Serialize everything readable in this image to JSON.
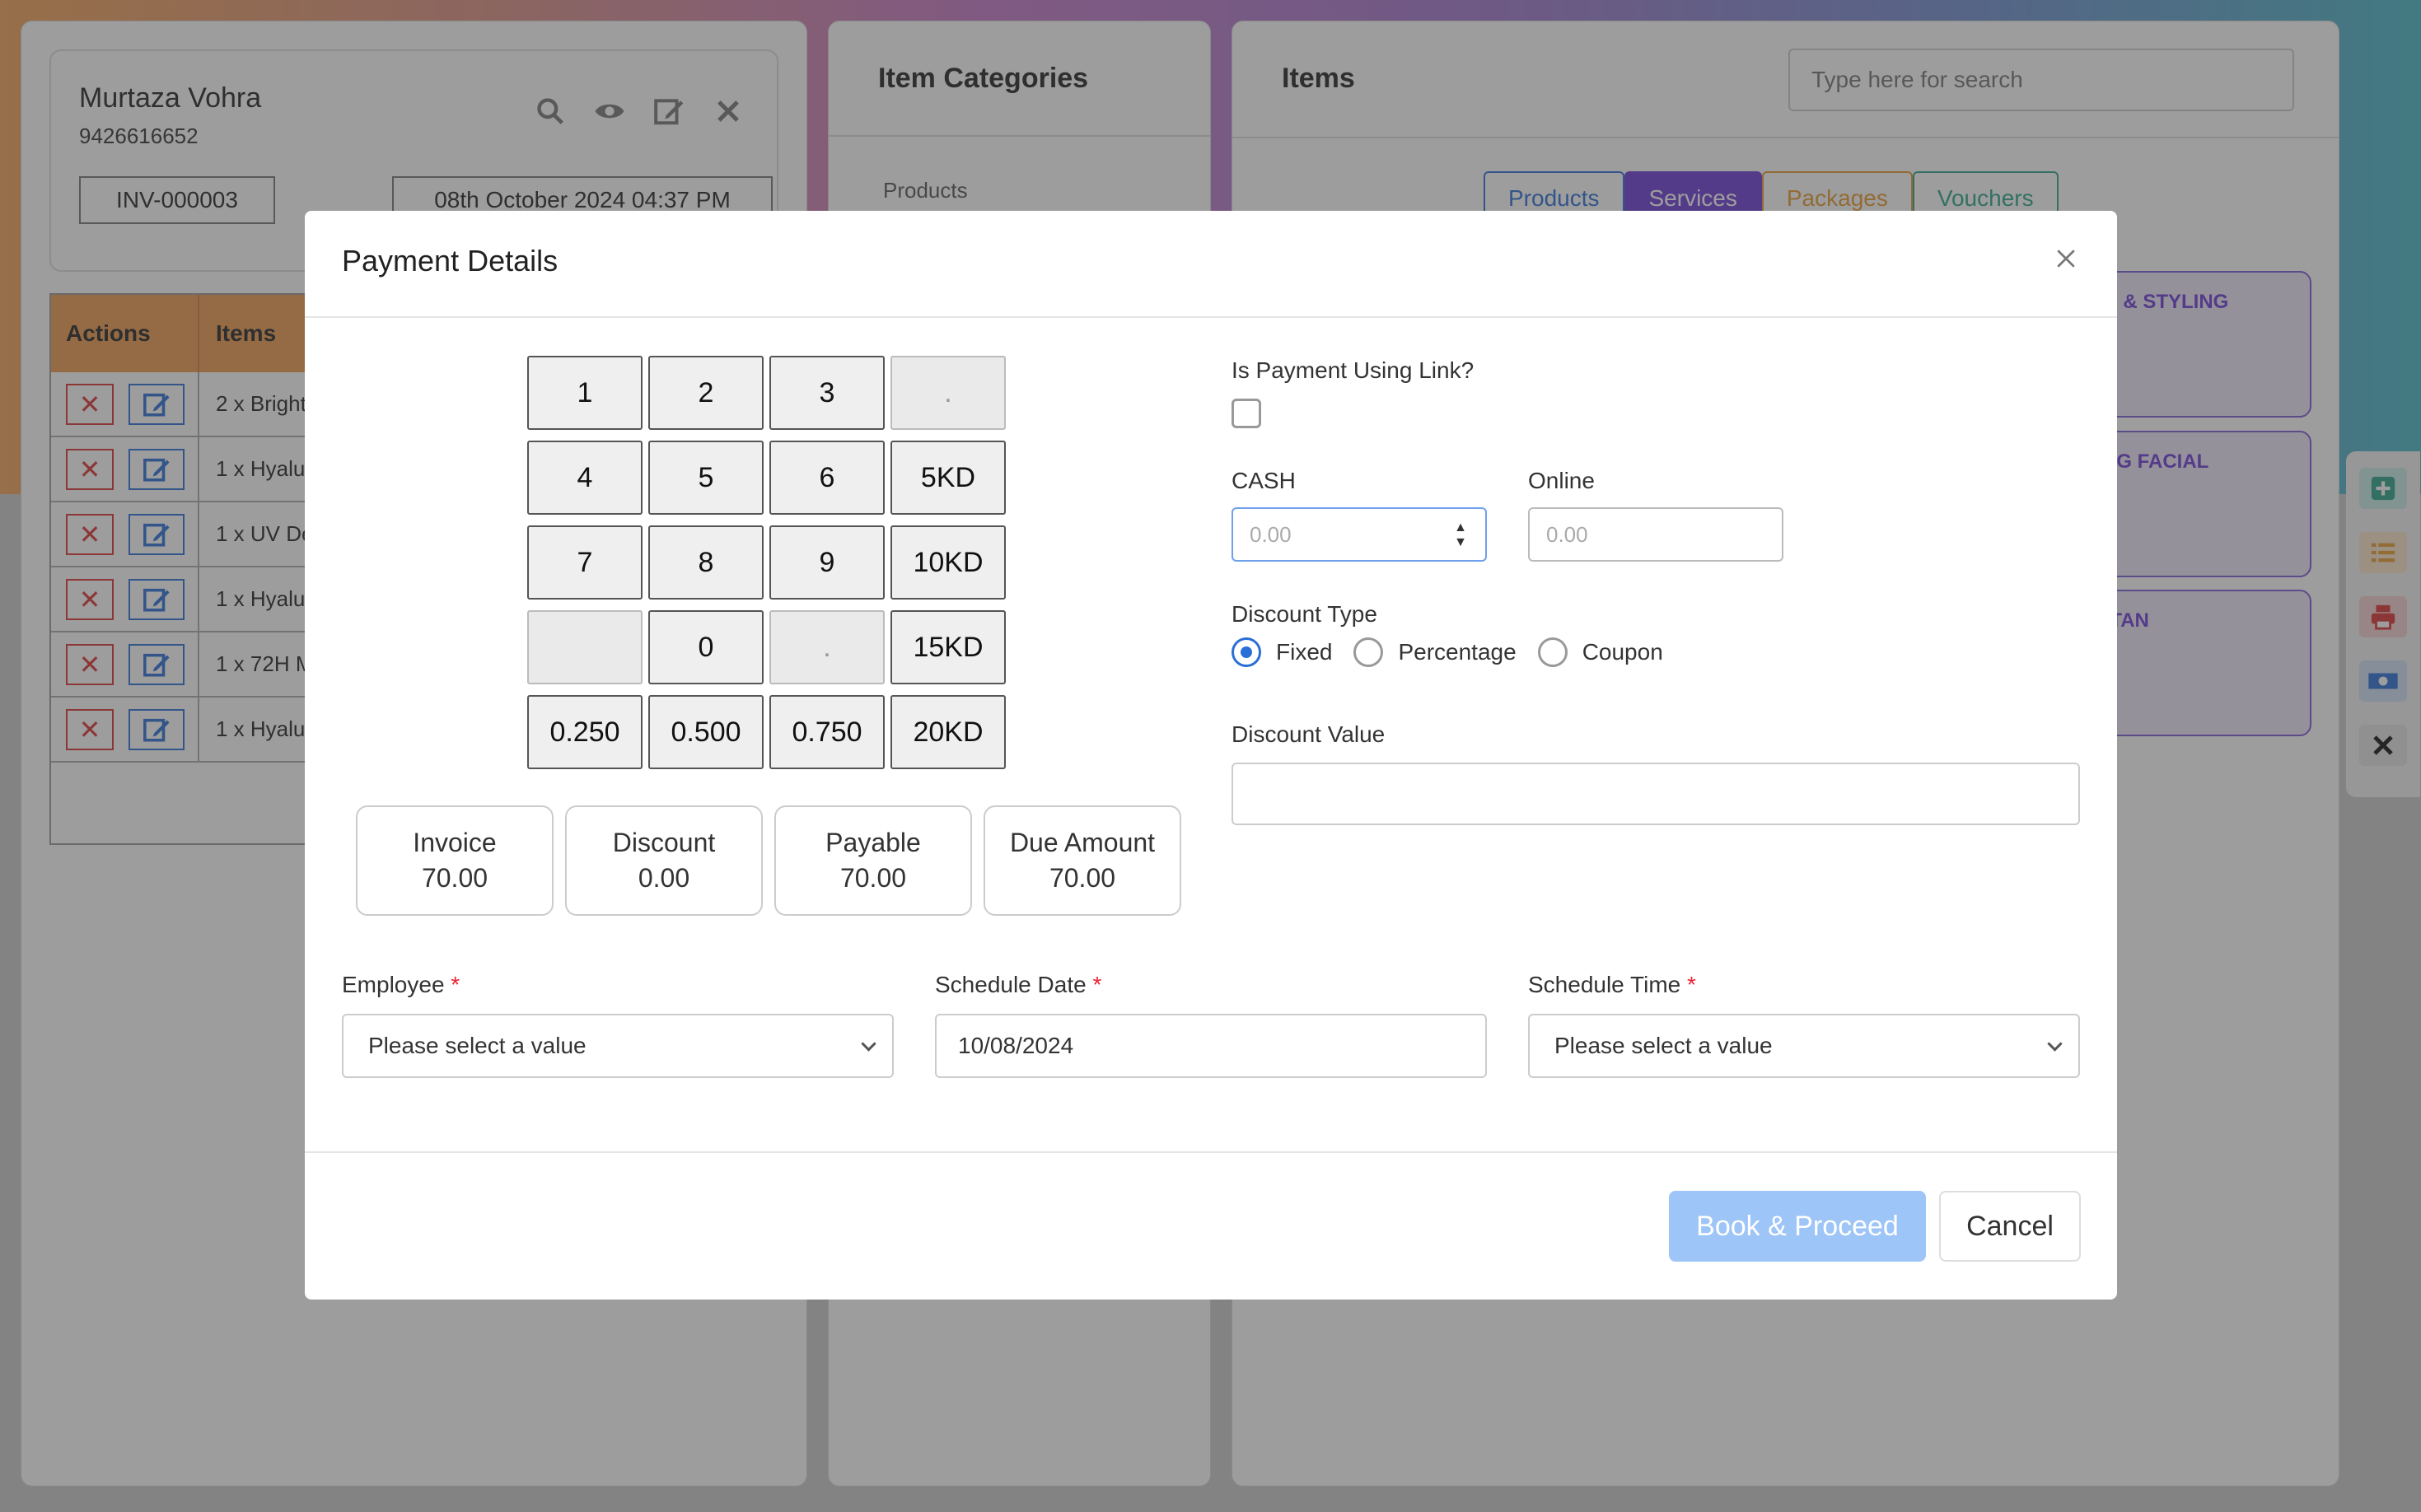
{
  "customer": {
    "name": "Murtaza Vohra",
    "phone": "9426616652",
    "invoice_no": "INV-000003",
    "datetime": "08th October 2024 04:37 PM"
  },
  "table": {
    "headers": [
      "Actions",
      "Items"
    ],
    "rows": [
      "2 x Bright",
      "1 x Hyalu",
      "1 x UV De",
      "1 x Hyalu",
      "1 x 72H M",
      "1 x Hyalu"
    ]
  },
  "categories": {
    "title": "Item Categories",
    "items": [
      "Products"
    ]
  },
  "items_panel": {
    "title": "Items",
    "search_placeholder": "Type here for search",
    "tabs": [
      "Products",
      "Services",
      "Packages",
      "Vouchers"
    ],
    "active_tab": "Services",
    "service_cards": [
      "ING & STYLING",
      "NING FACIAL",
      "DETAN"
    ]
  },
  "side_toolbar": [
    "plus-icon",
    "list-icon",
    "print-icon",
    "cash-icon",
    "close-icon"
  ],
  "modal": {
    "title": "Payment Details",
    "keypad": [
      "1",
      "2",
      "3",
      ".",
      "4",
      "5",
      "6",
      "5KD",
      "7",
      "8",
      "9",
      "10KD",
      "",
      "0",
      ".",
      "15KD",
      "0.250",
      "0.500",
      "0.750",
      "20KD"
    ],
    "summary": [
      {
        "label": "Invoice",
        "value": "70.00"
      },
      {
        "label": "Discount",
        "value": "0.00"
      },
      {
        "label": "Payable",
        "value": "70.00"
      },
      {
        "label": "Due Amount",
        "value": "70.00"
      }
    ],
    "payment_link_label": "Is Payment Using Link?",
    "payment_link_checked": false,
    "cash_label": "CASH",
    "cash_placeholder": "0.00",
    "online_label": "Online",
    "online_placeholder": "0.00",
    "discount_type_label": "Discount Type",
    "discount_types": [
      "Fixed",
      "Percentage",
      "Coupon"
    ],
    "discount_type_selected": "Fixed",
    "discount_value_label": "Discount Value",
    "discount_value": "",
    "employee_label": "Employee",
    "employee_value": "Please select a value",
    "schedule_date_label": "Schedule Date",
    "schedule_date_value": "10/08/2024",
    "schedule_time_label": "Schedule Time",
    "schedule_time_value": "Please select a value",
    "required_mark": "*",
    "book_label": "Book & Proceed",
    "cancel_label": "Cancel"
  },
  "colors": {
    "primary": "#2a6fd6",
    "services": "#6d3bd6",
    "packages": "#e89a2e",
    "vouchers": "#2aa58a",
    "table_header": "#ee9a4e",
    "book_button": "#9ec5f7"
  }
}
